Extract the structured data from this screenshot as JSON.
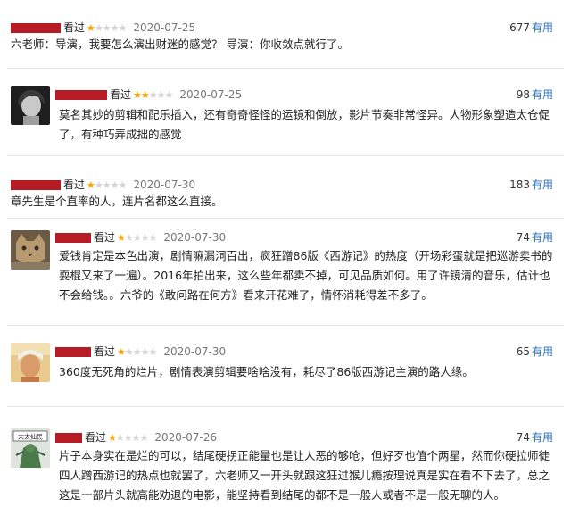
{
  "useful_label": "有用",
  "seen_label": "看过",
  "reviews": [
    {
      "stars": 1,
      "date": "2020-07-25",
      "useful_count": "677",
      "content": "六老师：导演，我要怎么演出财迷的感觉？ 导演：你收敛点就行了。",
      "avatar": "none"
    },
    {
      "stars": 2,
      "date": "2020-07-25",
      "useful_count": "98",
      "content": "莫名其妙的剪辑和配乐插入，还有奇奇怪怪的运镜和倒放，影片节奏非常怪异。人物形象塑造太仓促了，有种巧弄成拙的感觉",
      "avatar": "portrait-bw"
    },
    {
      "stars": 1,
      "date": "2020-07-30",
      "useful_count": "183",
      "content": "章先生是个直率的人，连片名都这么直接。",
      "avatar": "none"
    },
    {
      "stars": 1,
      "date": "2020-07-30",
      "useful_count": "74",
      "content": "爱钱肯定是本色出演，剧情嘛漏洞百出，疯狂蹭86版《西游记》的热度（开场彩蛋就是把巡游卖书的耍棍又来了一遍）。2016年拍出来，这么些年都卖不掉，可见品质如何。用了许镜清的音乐，估计也不会给钱。。六爷的《敢问路在何方》看来开花难了，情怀消耗得差不多了。",
      "avatar": "cat"
    },
    {
      "stars": 1,
      "date": "2020-07-30",
      "useful_count": "65",
      "content": "360度无死角的烂片，剧情表演剪辑要啥啥没有，耗尽了86版西游记主演的路人缘。",
      "avatar": "photo-face"
    },
    {
      "stars": 1,
      "date": "2020-07-26",
      "useful_count": "74",
      "content": "片子本身实在是烂的可以，结尾硬拐正能量也是让人恶的够呛，但好歹也值个两星，然而你硬拉师徒四人蹭西游记的热点也就罢了，六老师又一开头就跟这狂过猴儿瘾按理说真是实在看不下去了，总之这是一部片头就高能劝退的电影，能坚持看到结尾的都不是一般人或者不是一般无聊的人。",
      "avatar": "poster",
      "avatar_text": "大太仙民"
    }
  ]
}
